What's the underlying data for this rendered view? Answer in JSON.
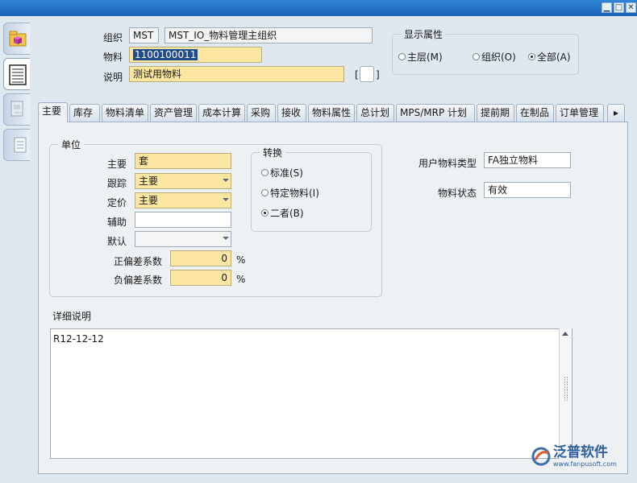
{
  "header": {
    "org_label": "组织",
    "org_code": "MST",
    "org_name": "MST_IO_物料管理主组织",
    "item_label": "物料",
    "item_value": "1100100011",
    "desc_label": "说明",
    "desc_value": "测试用物料",
    "bracket_left": "[",
    "bracket_right": "]"
  },
  "display_attrs": {
    "title": "显示属性",
    "options": [
      "主层(M)",
      "组织(O)",
      "全部(A)"
    ],
    "selected": "全部(A)"
  },
  "tabs": [
    "主要",
    "库存",
    "物料清单",
    "资产管理",
    "成本计算",
    "采购",
    "接收",
    "物料属性",
    "总计划",
    "MPS/MRP 计划",
    "提前期",
    "在制品",
    "订单管理"
  ],
  "active_tab": "主要",
  "unit_group": {
    "title": "单位",
    "main_label": "主要",
    "main_value": "套",
    "track_label": "跟踪",
    "track_value": "主要",
    "pricing_label": "定价",
    "pricing_value": "主要",
    "aux_label": "辅助",
    "aux_value": "",
    "default_label": "默认",
    "default_value": "",
    "pos_dev_label": "正偏差系数",
    "pos_dev_value": "0",
    "neg_dev_label": "负偏差系数",
    "neg_dev_value": "0",
    "percent": "%"
  },
  "convert_group": {
    "title": "转换",
    "options": [
      "标准(S)",
      "特定物料(I)",
      "二者(B)"
    ],
    "selected": "二者(B)"
  },
  "user_item_type_label": "用户物料类型",
  "user_item_type_value": "FA独立物料",
  "item_status_label": "物料状态",
  "item_status_value": "有效",
  "detail_label": "详细说明",
  "detail_text": "R12-12-12",
  "logo": {
    "text": "泛普软件",
    "url_text": "www.fanpusoft.com"
  },
  "colors": {
    "titlebar": "#1c63b3",
    "required": "#fbe7a1",
    "panel": "#eef1f4"
  }
}
